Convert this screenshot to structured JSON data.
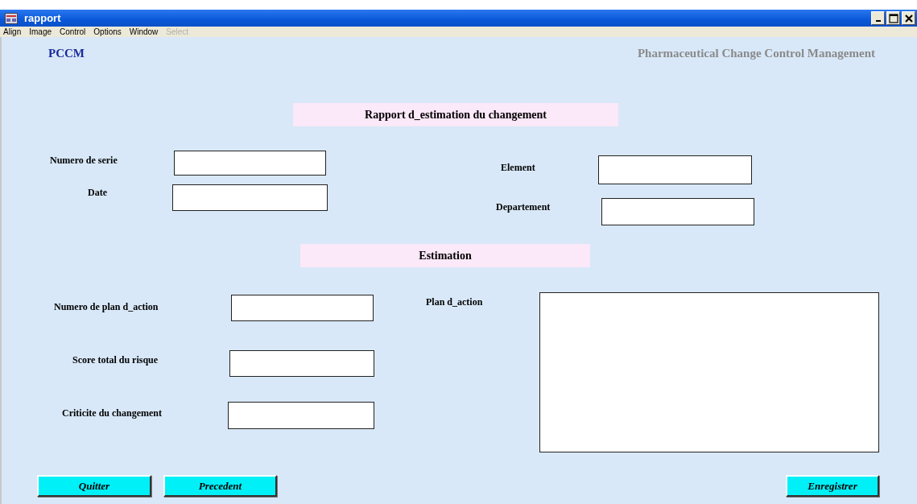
{
  "window": {
    "title": "rapport"
  },
  "menu": [
    {
      "label": "Align",
      "disabled": false
    },
    {
      "label": "Image",
      "disabled": false
    },
    {
      "label": "Control",
      "disabled": false
    },
    {
      "label": "Options",
      "disabled": false
    },
    {
      "label": "Window",
      "disabled": false
    },
    {
      "label": "Select",
      "disabled": true
    }
  ],
  "header": {
    "logo": "PCCM",
    "tagline": "Pharmaceutical Change Control Management"
  },
  "controls": [
    {
      "kind": "heading",
      "text": "Rapport d_estimation du changement"
    },
    {
      "kind": "label",
      "text": "Numero de serie"
    },
    {
      "kind": "field"
    },
    {
      "kind": "label",
      "text": "Date"
    },
    {
      "kind": "field"
    },
    {
      "kind": "label",
      "text": "Element"
    },
    {
      "kind": "field"
    },
    {
      "kind": "label",
      "text": "Departement"
    },
    {
      "kind": "field"
    },
    {
      "kind": "heading",
      "text": "Estimation"
    },
    {
      "kind": "label",
      "text": "Numero de plan d_action"
    },
    {
      "kind": "field"
    },
    {
      "kind": "label",
      "text": "Plan d_action"
    },
    {
      "kind": "textarea"
    },
    {
      "kind": "label",
      "text": "Score total du risque"
    },
    {
      "kind": "field"
    },
    {
      "kind": "label",
      "text": "Criticite du changement"
    },
    {
      "kind": "field"
    },
    {
      "kind": "button",
      "text": "Quitter"
    },
    {
      "kind": "button",
      "text": "Precedent"
    },
    {
      "kind": "button",
      "text": "Enregistrer"
    }
  ]
}
